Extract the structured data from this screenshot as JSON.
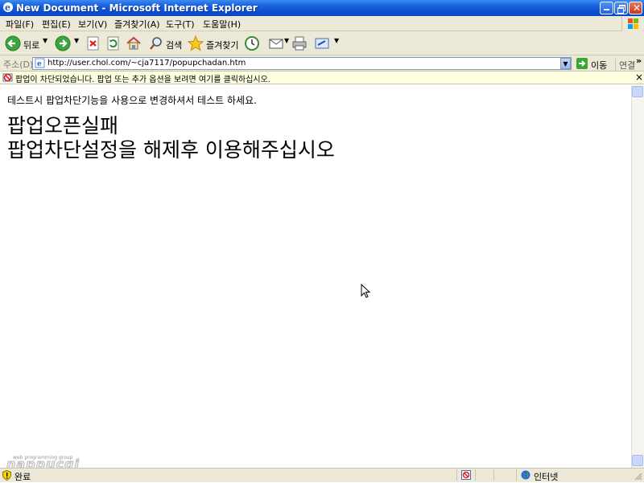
{
  "window": {
    "title": "New Document - Microsoft Internet Explorer"
  },
  "menu": [
    "파일(F)",
    "편집(E)",
    "보기(V)",
    "즐겨찾기(A)",
    "도구(T)",
    "도움말(H)"
  ],
  "toolbar": {
    "back_label": "뒤로",
    "search_label": "검색",
    "favorites_label": "즐겨찾기"
  },
  "address": {
    "label": "주소(D)",
    "url": "http://user.chol.com/~cja7117/popupchadan.htm",
    "go_label": "이동",
    "links_label": "연결"
  },
  "infobar": {
    "message": "팝업이 차단되었습니다.  팝업 또는 추가 옵션을 보려면 여기를 클릭하십시오.",
    "close": "×"
  },
  "content": {
    "instruction": "테스트시 팝업차단기능을 사용으로 변경하셔서 테스트 하세요.",
    "headline_1": "팝업오픈실패",
    "headline_2": "팝업차단설정을 해제후 이용해주십시오"
  },
  "watermark": {
    "text": "nappucgi",
    "subtext": "web programming group"
  },
  "status": {
    "text": "완료",
    "zone": "인터넷"
  },
  "colors": {
    "title_bar": "#0a4fd1",
    "chrome": "#ece9d8",
    "infobar": "#ffffe1"
  }
}
